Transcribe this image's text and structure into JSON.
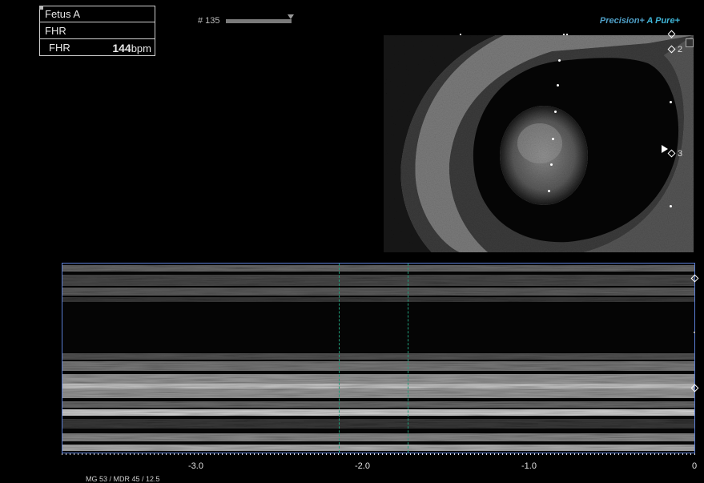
{
  "measurement": {
    "fetus": "Fetus A",
    "heading": "FHR",
    "label": "FHR",
    "value": "144",
    "unit": "bpm"
  },
  "frame": {
    "label": "# 135"
  },
  "brand": {
    "part1": "Precision+",
    "part2": "A Pure+"
  },
  "image_markers": {
    "marker2": "2",
    "marker3": "3"
  },
  "time_axis": {
    "labels": [
      "-3.0",
      "-2.0",
      "-1.0",
      "0"
    ]
  },
  "bottom_text": "MG 53   / MDR 45   / 12.5"
}
